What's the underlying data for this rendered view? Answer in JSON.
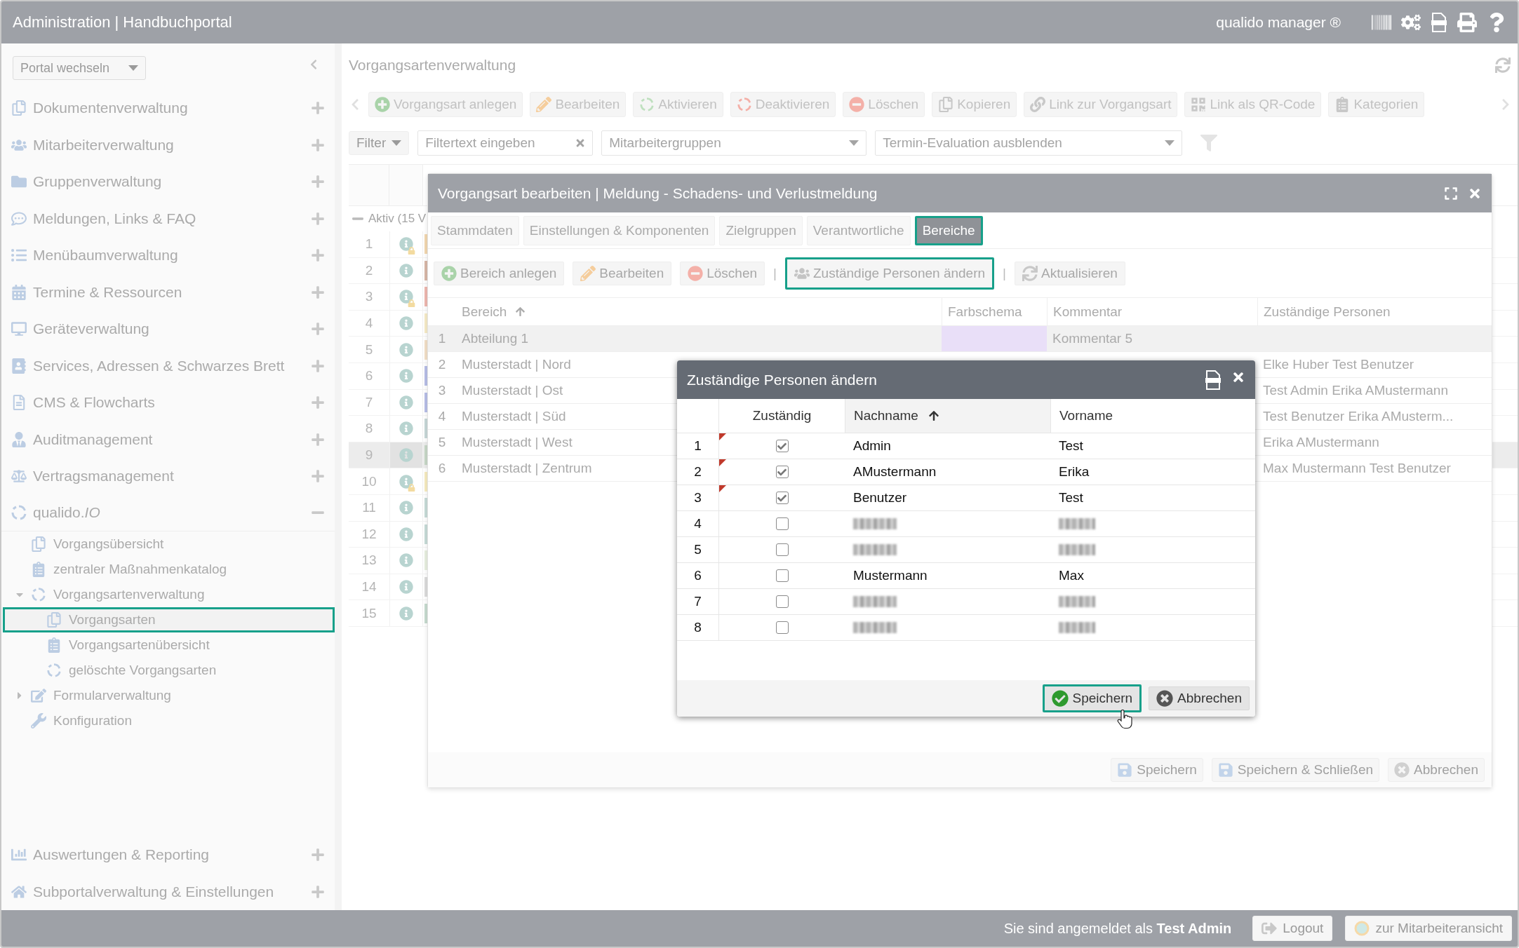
{
  "app_bar": {
    "title": "Administration | Handbuchportal",
    "product": "qualido manager ®"
  },
  "sidebar": {
    "portal_select": "Portal wechseln",
    "sections": [
      {
        "label": "Dokumentenverwaltung",
        "expanded": false
      },
      {
        "label": "Mitarbeiterverwaltung",
        "expanded": false
      },
      {
        "label": "Gruppenverwaltung",
        "expanded": false
      },
      {
        "label": "Meldungen, Links & FAQ",
        "expanded": false
      },
      {
        "label": "Menübaumverwaltung",
        "expanded": false
      },
      {
        "label": "Termine & Ressourcen",
        "expanded": false
      },
      {
        "label": "Geräteverwaltung",
        "expanded": false
      },
      {
        "label": "Services, Adressen & Schwarzes Brett",
        "expanded": false
      },
      {
        "label": "CMS & Flowcharts",
        "expanded": false
      },
      {
        "label": "Auditmanagement",
        "expanded": false
      },
      {
        "label": "Vertragsmanagement",
        "expanded": false
      },
      {
        "label": "qualido.*IO*",
        "expanded": true,
        "children": [
          {
            "label": "Vorgangsübersicht",
            "selected": false
          },
          {
            "label": "zentraler Maßnahmenkatalog",
            "selected": false
          },
          {
            "label": "Vorgangsartenverwaltung",
            "selected": false,
            "expanded": true,
            "children": [
              {
                "label": "Vorgangsarten",
                "selected": true
              },
              {
                "label": "Vorgangsartenübersicht",
                "selected": false
              },
              {
                "label": "gelöschte Vorgangsarten",
                "selected": false
              }
            ]
          },
          {
            "label": "Formularverwaltung",
            "selected": false,
            "expanded": false
          },
          {
            "label": "Konfiguration",
            "selected": false
          }
        ]
      }
    ],
    "bottom_sections": [
      {
        "label": "Auswertungen & Reporting",
        "expanded": false
      },
      {
        "label": "Subportalverwaltung & Einstellungen",
        "expanded": false
      }
    ]
  },
  "main": {
    "title": "Vorgangsartenverwaltung",
    "toolbar": [
      "Vorgangsart anlegen",
      "Bearbeiten",
      "Aktivieren",
      "Deaktivieren",
      "Löschen",
      "Kopieren",
      "Link zur Vorgangsart",
      "Link als QR-Code",
      "Kategorien"
    ],
    "filter": {
      "button": "Filter",
      "placeholder": "Filtertext eingeben",
      "groups": "Mitarbeitergruppen",
      "evaluation": "Termin-Evaluation ausblenden"
    },
    "group_row": "Aktiv (15 V",
    "rows": [
      {
        "number": "1",
        "locked": true,
        "selected": false,
        "color": "#f3d8b0"
      },
      {
        "number": "2",
        "locked": false,
        "selected": false,
        "color": "#d9b8a8"
      },
      {
        "number": "3",
        "locked": true,
        "selected": false,
        "color": "#f0b8b0"
      },
      {
        "number": "4",
        "locked": false,
        "selected": false,
        "color": "#f7ecc8"
      },
      {
        "number": "5",
        "locked": false,
        "selected": false,
        "color": "#f3e0c8"
      },
      {
        "number": "6",
        "locked": false,
        "selected": false,
        "color": "#b8bfe8"
      },
      {
        "number": "7",
        "locked": false,
        "selected": false,
        "color": "#b8bfe8"
      },
      {
        "number": "8",
        "locked": false,
        "selected": false,
        "color": "#c8d8d8"
      },
      {
        "number": "9",
        "locked": false,
        "selected": true,
        "color": "#c8d8c8"
      },
      {
        "number": "10",
        "locked": true,
        "selected": false,
        "color": "#f7ecc0"
      },
      {
        "number": "11",
        "locked": false,
        "selected": false,
        "color": "#c8dcd8"
      },
      {
        "number": "12",
        "locked": false,
        "selected": false,
        "color": "#c8dcd8"
      },
      {
        "number": "13",
        "locked": false,
        "selected": false,
        "color": "#e8f0e0"
      },
      {
        "number": "14",
        "locked": false,
        "selected": false,
        "color": "#dcdcdc"
      },
      {
        "number": "15",
        "locked": false,
        "selected": false,
        "color": "#c8dcd0"
      }
    ]
  },
  "editor": {
    "title": "Vorgangsart bearbeiten | Meldung - Schadens- und Verlustmeldung",
    "tabs": [
      {
        "label": "Stammdaten",
        "selected": false
      },
      {
        "label": "Einstellungen & Komponenten",
        "selected": false
      },
      {
        "label": "Zielgruppen",
        "selected": false
      },
      {
        "label": "Verantwortliche",
        "selected": false
      },
      {
        "label": "Bereiche",
        "selected": true
      }
    ],
    "toolbar": [
      {
        "kind": "button",
        "label": "Bereich anlegen",
        "highlighted": false
      },
      {
        "kind": "button",
        "label": "Bearbeiten",
        "highlighted": false
      },
      {
        "kind": "button",
        "label": "Löschen",
        "highlighted": false
      },
      {
        "kind": "separator",
        "label": "|"
      },
      {
        "kind": "button",
        "label": "Zuständige Personen ändern",
        "highlighted": true
      },
      {
        "kind": "separator",
        "label": "|"
      },
      {
        "kind": "button",
        "label": "Aktualisieren",
        "highlighted": false
      }
    ],
    "columns": [
      "Bereich",
      "Farbschema",
      "Kommentar",
      "Zuständige Personen"
    ],
    "rows": [
      {
        "number": "1",
        "bereich": "Abteilung 1",
        "color": "#e9dff8",
        "kommentar": "Kommentar 5",
        "selected": true
      },
      {
        "number": "2",
        "bereich": "Musterstadt | Nord",
        "personen": "Elke Huber Test Benutzer",
        "selected": false
      },
      {
        "number": "3",
        "bereich": "Musterstadt | Ost",
        "personen": "Test Admin Erika AMustermann",
        "selected": false
      },
      {
        "number": "4",
        "bereich": "Musterstadt | Süd",
        "personen": "Test Benutzer Erika AMusterm...",
        "selected": false
      },
      {
        "number": "5",
        "bereich": "Musterstadt | West",
        "personen": "Erika AMustermann",
        "selected": false
      },
      {
        "number": "6",
        "bereich": "Musterstadt | Zentrum",
        "personen": "Max Mustermann Test Benutzer",
        "selected": false
      }
    ],
    "buttons": [
      "Speichern",
      "Speichern & Schließen",
      "Abbrechen"
    ]
  },
  "dialog": {
    "title": "Zuständige Personen ändern",
    "columns": [
      "Zuständig",
      "Nachname",
      "Vorname"
    ],
    "rows": [
      {
        "number": "1",
        "checked": true,
        "changed": true,
        "blurred": false,
        "nachname": "Admin",
        "vorname": "Test"
      },
      {
        "number": "2",
        "checked": true,
        "changed": true,
        "blurred": false,
        "nachname": "AMustermann",
        "vorname": "Erika"
      },
      {
        "number": "3",
        "checked": true,
        "changed": true,
        "blurred": false,
        "nachname": "Benutzer",
        "vorname": "Test"
      },
      {
        "number": "4",
        "checked": false,
        "changed": false,
        "blurred": true
      },
      {
        "number": "5",
        "checked": false,
        "changed": false,
        "blurred": true
      },
      {
        "number": "6",
        "checked": false,
        "changed": false,
        "blurred": false,
        "nachname": "Mustermann",
        "vorname": "Max"
      },
      {
        "number": "7",
        "checked": false,
        "changed": false,
        "blurred": true
      },
      {
        "number": "8",
        "checked": false,
        "changed": false,
        "blurred": true
      }
    ],
    "buttons": [
      {
        "kind": "save",
        "label": "Speichern",
        "highlighted": true
      },
      {
        "kind": "cancel",
        "label": "Abbrechen",
        "highlighted": false
      }
    ]
  },
  "status_bar": {
    "login": "Sie sind angemeldet als **Test Admin**",
    "logout": "Logout",
    "switch_view": "zur Mitarbeiteransicht"
  }
}
